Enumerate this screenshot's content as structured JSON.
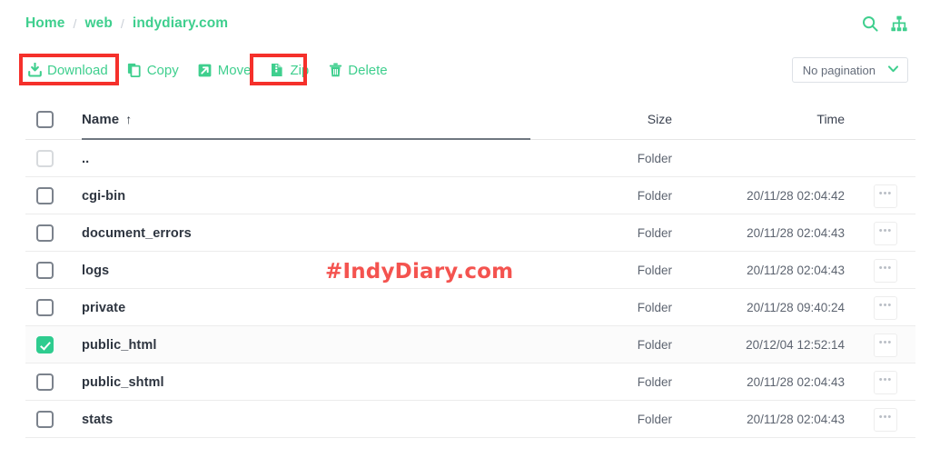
{
  "breadcrumb": {
    "separator": "/",
    "items": [
      {
        "label": "Home"
      },
      {
        "label": "web"
      },
      {
        "label": "indydiary.com"
      }
    ]
  },
  "header_icons": [
    {
      "name": "search-icon",
      "label": "Search"
    },
    {
      "name": "sitemap-icon",
      "label": "Sitemap"
    }
  ],
  "toolbar": {
    "actions": [
      {
        "label": "Download",
        "icon": "download-icon",
        "highlighted": true
      },
      {
        "label": "Copy",
        "icon": "copy-icon",
        "highlighted": false
      },
      {
        "label": "Move",
        "icon": "move-icon",
        "highlighted": false
      },
      {
        "label": "Zip",
        "icon": "zip-icon",
        "highlighted": true
      },
      {
        "label": "Delete",
        "icon": "trash-icon",
        "highlighted": false
      }
    ],
    "pagination": {
      "value": "No pagination",
      "chevron": "⌄"
    }
  },
  "table": {
    "columns": {
      "name": "Name",
      "size": "Size",
      "time": "Time"
    },
    "sort": {
      "column": "Name",
      "direction": "asc",
      "arrow": "↑"
    },
    "select_all_checked": false,
    "menu_glyph": "•••",
    "rows": [
      {
        "name": "..",
        "size": "Folder",
        "time": "",
        "checked": false,
        "checkbox_disabled": true,
        "has_menu": false
      },
      {
        "name": "cgi-bin",
        "size": "Folder",
        "time": "20/11/28 02:04:42",
        "checked": false,
        "checkbox_disabled": false,
        "has_menu": true
      },
      {
        "name": "document_errors",
        "size": "Folder",
        "time": "20/11/28 02:04:43",
        "checked": false,
        "checkbox_disabled": false,
        "has_menu": true
      },
      {
        "name": "logs",
        "size": "Folder",
        "time": "20/11/28 02:04:43",
        "checked": false,
        "checkbox_disabled": false,
        "has_menu": true
      },
      {
        "name": "private",
        "size": "Folder",
        "time": "20/11/28 09:40:24",
        "checked": false,
        "checkbox_disabled": false,
        "has_menu": true
      },
      {
        "name": "public_html",
        "size": "Folder",
        "time": "20/12/04 12:52:14",
        "checked": true,
        "checkbox_disabled": false,
        "has_menu": true
      },
      {
        "name": "public_shtml",
        "size": "Folder",
        "time": "20/11/28 02:04:43",
        "checked": false,
        "checkbox_disabled": false,
        "has_menu": true
      },
      {
        "name": "stats",
        "size": "Folder",
        "time": "20/11/28 02:04:43",
        "checked": false,
        "checkbox_disabled": false,
        "has_menu": true
      }
    ]
  },
  "watermark": {
    "text": "#IndyDiary.com"
  },
  "colors": {
    "accent_green": "#3fcf8e",
    "checkbox_green": "#2ecc8f",
    "highlight_red": "#f5302b",
    "watermark_red": "#f4534f",
    "text_dark": "#2e3540",
    "text_muted": "#5d6470"
  }
}
